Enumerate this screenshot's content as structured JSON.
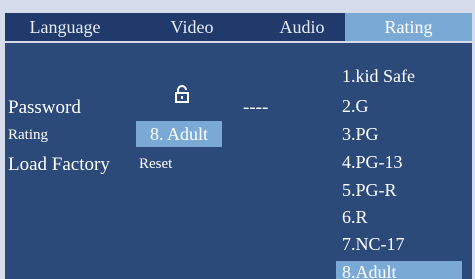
{
  "tabs": [
    {
      "label": "Language"
    },
    {
      "label": "Video"
    },
    {
      "label": "Audio"
    },
    {
      "label": "Rating",
      "active": true
    }
  ],
  "settings": {
    "password_label": "Password",
    "password_icon": "unlocked-padlock-icon",
    "password_value": "----",
    "rating_label": "Rating",
    "rating_value": "8.  Adult",
    "load_factory_label": "Load Factory",
    "load_factory_value": "Reset"
  },
  "rating_options": [
    "1.kid Safe",
    "2.G",
    "3.PG",
    "4.PG-13",
    "5.PG-R",
    "6.R",
    "7.NC-17",
    "8.Adult"
  ],
  "selected_option_index": 7,
  "colors": {
    "tabbar_bg": "#1f3a6b",
    "panel_bg": "#2b4a7a",
    "highlight": "#7ba9d6",
    "frame_bg": "#d6dcec"
  }
}
